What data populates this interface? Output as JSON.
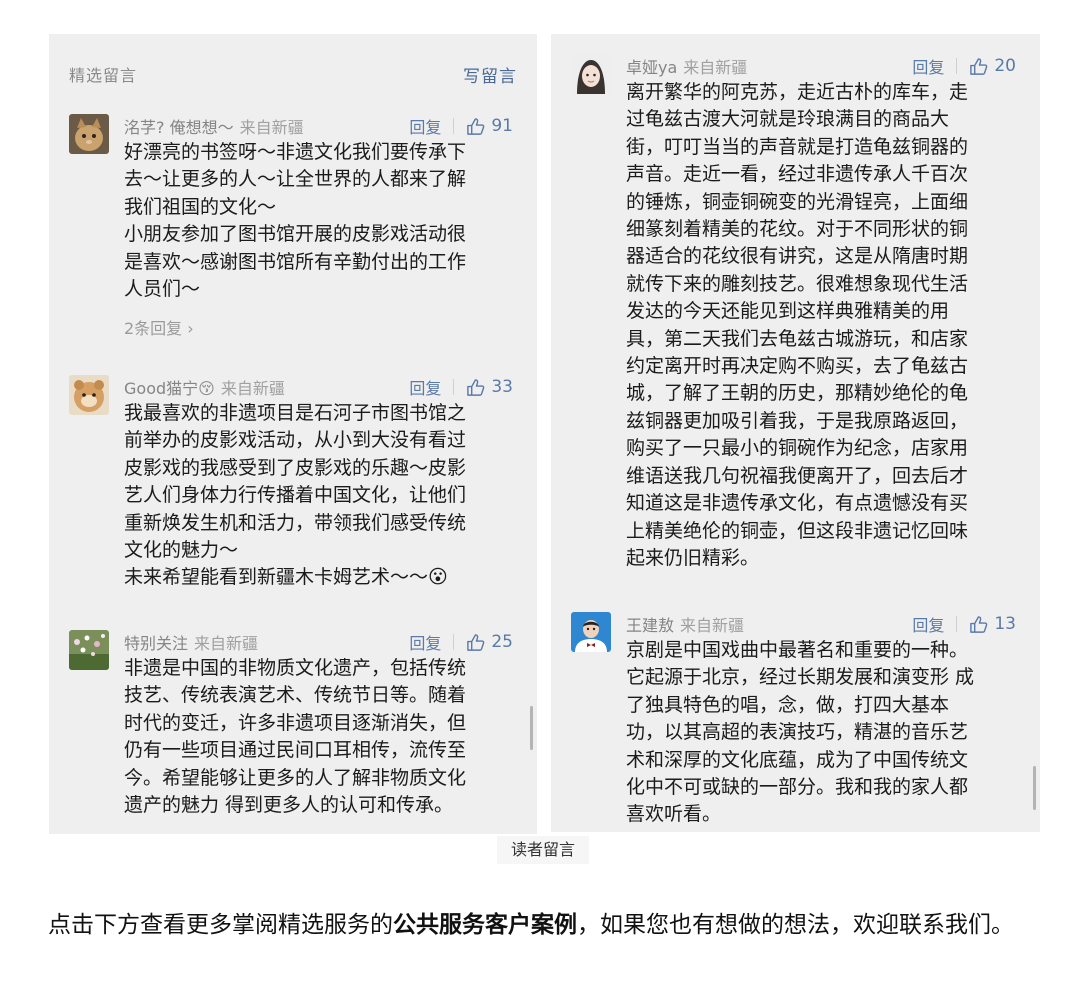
{
  "left_panel": {
    "header_title": "精选留言",
    "write_label": "写留言",
    "comments": [
      {
        "name": "洺芓? 俺想想～",
        "location": "来自新疆",
        "reply_label": "回复",
        "likes": "91",
        "avatar_icon": "cat-avatar-icon",
        "lines": [
          "好漂亮的书签呀～非遗文化我们要传承下",
          "去～让更多的人～让全世界的人都来了解",
          "我们祖国的文化～",
          "小朋友参加了图书馆开展的皮影戏活动很",
          "是喜欢～感谢图书馆所有辛勤付出的工作",
          "人员们～"
        ],
        "sub_replies": "2条回复 ›"
      },
      {
        "name": "Good猫宁",
        "name_emoji": "😚",
        "location": "来自新疆",
        "reply_label": "回复",
        "likes": "33",
        "avatar_icon": "plush-toy-avatar-icon",
        "lines": [
          "我最喜欢的非遗项目是石河子市图书馆之",
          "前举办的皮影戏活动，从小到大没有看过",
          "皮影戏的我感受到了皮影戏的乐趣～皮影",
          "艺人们身体力行传播着中国文化，让他们",
          "重新焕发生机和活力，带领我们感受传统",
          "文化的魅力～",
          "未来希望能看到新疆木卡姆艺术～～😮"
        ]
      },
      {
        "name": "特别关注",
        "location": "来自新疆",
        "reply_label": "回复",
        "likes": "25",
        "avatar_icon": "flowers-avatar-icon",
        "lines": [
          "非遗是中国的非物质文化遗产，包括传统",
          "技艺、传统表演艺术、传统节日等。随着",
          "时代的变迁，许多非遗项目逐渐消失，但",
          "仍有一些项目通过民间口耳相传，流传至",
          "今。希望能够让更多的人了解非物质文化",
          "遗产的魅力 得到更多人的认可和传承。"
        ]
      }
    ]
  },
  "right_panel": {
    "comments": [
      {
        "name": "卓娅ya",
        "location": "来自新疆",
        "reply_label": "回复",
        "likes": "20",
        "avatar_icon": "girl-avatar-icon",
        "lines": [
          "离开繁华的阿克苏，走近古朴的库车，走",
          "过龟兹古渡大河就是玲琅满目的商品大",
          "街，叮叮当当的声音就是打造龟兹铜器的",
          "声音。走近一看，经过非遗传承人千百次",
          "的锤炼，铜壶铜碗变的光滑锃亮，上面细",
          "细篆刻着精美的花纹。对于不同形状的铜",
          "器适合的花纹很有讲究，这是从隋唐时期",
          "就传下来的雕刻技艺。很难想象现代生活",
          "发达的今天还能见到这样典雅精美的用",
          "具，第二天我们去龟兹古城游玩，和店家",
          "约定离开时再决定购不购买，去了龟兹古",
          "城，了解了王朝的历史，那精妙绝伦的龟",
          "兹铜器更加吸引着我，于是我原路返回，",
          "购买了一只最小的铜碗作为纪念，店家用",
          "维语送我几句祝福我便离开了，回去后才",
          "知道这是非遗传承文化，有点遗憾没有买",
          "上精美绝伦的铜壶，但这段非遗记忆回味",
          "起来仍旧精彩。"
        ]
      },
      {
        "name": "王建敖",
        "location": "来自新疆",
        "reply_label": "回复",
        "likes": "13",
        "avatar_icon": "boy-avatar-icon",
        "lines": [
          "京剧是中国戏曲中最著名和重要的一种。",
          "它起源于北京，经过长期发展和演变形 成",
          "了独具特色的唱，念，做，打四大基本",
          "功，以其高超的表演技巧，精湛的音乐艺",
          "术和深厚的文化底蕴，成为了中国传统文",
          "化中不可或缺的一部分。我和我的家人都",
          "喜欢听看。"
        ]
      }
    ]
  },
  "caption": "读者留言",
  "footer": {
    "prefix": "点击下方查看更多掌阅精选服务的",
    "bold": "公共服务客户案例",
    "suffix": "，如果您也有想做的想法，欢迎联系我们。"
  },
  "colors": {
    "panel_bg": "#efefef",
    "link_blue": "#5a7aa8",
    "meta_gray": "#8c8c8c"
  }
}
